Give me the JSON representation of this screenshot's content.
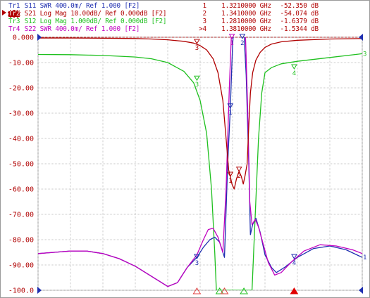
{
  "traces": [
    {
      "id": "Tr1",
      "param": "S11",
      "format": "SWR",
      "scale": "400.0m/",
      "ref": "Ref 1.000",
      "channel": "[F2]",
      "color": "#1f2fb0",
      "active": false
    },
    {
      "id": "Tr2",
      "param": "S21",
      "format": "Log Mag",
      "scale": "10.00dB/",
      "ref": "Ref 0.000dB",
      "channel": "[F2]",
      "color": "#b00000",
      "active": true
    },
    {
      "id": "Tr3",
      "param": "S12",
      "format": "Log Mag",
      "scale": "1.000dB/",
      "ref": "Ref 0.000dB",
      "channel": "[F2]",
      "color": "#1fc01f",
      "active": false
    },
    {
      "id": "Tr4",
      "param": "S22",
      "format": "SWR",
      "scale": "400.0m/",
      "ref": "Ref 1.000",
      "channel": "[F2]",
      "color": "#c000c0",
      "active": false
    }
  ],
  "marker_readout": [
    {
      "num": "1",
      "freq": "1.3210000 GHz",
      "value": "-52.350 dB"
    },
    {
      "num": "2",
      "freq": "1.3410000 GHz",
      "value": "-54.074 dB"
    },
    {
      "num": "3",
      "freq": "1.2810000 GHz",
      "value": "-1.6379 dB"
    },
    {
      "num": ">4",
      "freq": "1.3810000 GHz",
      "value": "-1.5344 dB"
    }
  ],
  "chart_data": {
    "type": "line",
    "title": "",
    "xlabel": "",
    "ylabel": "",
    "yticks": [
      "0.000",
      "-10.00",
      "-20.00",
      "-30.00",
      "-40.00",
      "-50.00",
      "-60.00",
      "-70.00",
      "-80.00",
      "-90.00",
      "-100.0"
    ],
    "ylim": [
      -100,
      0
    ],
    "xlim": [
      0,
      10
    ],
    "grid": true,
    "series": [
      {
        "name": "Tr1",
        "color": "#1f2fb0",
        "points": [
          [
            0,
            -85.5
          ],
          [
            0.5,
            -85
          ],
          [
            1,
            -84.5
          ],
          [
            1.5,
            -84.5
          ],
          [
            2,
            -85.5
          ],
          [
            2.5,
            -87.5
          ],
          [
            3,
            -90.5
          ],
          [
            3.5,
            -94.5
          ],
          [
            4,
            -98.5
          ],
          [
            4.3,
            -97
          ],
          [
            4.6,
            -91
          ],
          [
            4.9,
            -87
          ],
          [
            5.1,
            -83
          ],
          [
            5.3,
            -80
          ],
          [
            5.45,
            -79
          ],
          [
            5.6,
            -81
          ],
          [
            5.75,
            -87
          ],
          [
            5.85,
            -50
          ],
          [
            5.93,
            -28
          ],
          [
            6.0,
            -3
          ],
          [
            6.05,
            5
          ],
          [
            6.3,
            5
          ],
          [
            6.35,
            2
          ],
          [
            6.42,
            -15
          ],
          [
            6.5,
            -50
          ],
          [
            6.55,
            -78
          ],
          [
            6.62,
            -74
          ],
          [
            6.72,
            -71.5
          ],
          [
            6.85,
            -77
          ],
          [
            7.0,
            -86
          ],
          [
            7.2,
            -91
          ],
          [
            7.35,
            -93
          ],
          [
            7.6,
            -91
          ],
          [
            8,
            -87
          ],
          [
            8.5,
            -83.5
          ],
          [
            9,
            -82.5
          ],
          [
            9.5,
            -84
          ],
          [
            10,
            -87
          ]
        ]
      },
      {
        "name": "Tr2",
        "color": "#b00000",
        "points": [
          [
            0,
            -0.3
          ],
          [
            1,
            -0.3
          ],
          [
            2,
            -0.4
          ],
          [
            3,
            -0.5
          ],
          [
            3.5,
            -0.7
          ],
          [
            4,
            -1
          ],
          [
            4.5,
            -1.6
          ],
          [
            4.8,
            -2.3
          ],
          [
            5.0,
            -3.3
          ],
          [
            5.2,
            -5
          ],
          [
            5.4,
            -8.5
          ],
          [
            5.55,
            -14
          ],
          [
            5.7,
            -25
          ],
          [
            5.8,
            -40
          ],
          [
            5.88,
            -52.5
          ],
          [
            5.93,
            -55
          ],
          [
            5.98,
            -58
          ],
          [
            6.05,
            -60
          ],
          [
            6.12,
            -56
          ],
          [
            6.2,
            -53
          ],
          [
            6.27,
            -55
          ],
          [
            6.33,
            -58
          ],
          [
            6.38,
            -55
          ],
          [
            6.45,
            -50
          ],
          [
            6.5,
            -35
          ],
          [
            6.55,
            -22
          ],
          [
            6.62,
            -14
          ],
          [
            6.72,
            -9
          ],
          [
            6.85,
            -6
          ],
          [
            7.0,
            -4
          ],
          [
            7.2,
            -2.7
          ],
          [
            7.5,
            -1.8
          ],
          [
            8,
            -1.2
          ],
          [
            9,
            -0.7
          ],
          [
            10,
            -0.5
          ]
        ]
      },
      {
        "name": "Tr3",
        "color": "#1fc01f",
        "points": [
          [
            0,
            -6.8
          ],
          [
            1,
            -6.9
          ],
          [
            2,
            -7.2
          ],
          [
            3,
            -7.8
          ],
          [
            3.5,
            -8.5
          ],
          [
            4,
            -10
          ],
          [
            4.5,
            -13.5
          ],
          [
            4.8,
            -18
          ],
          [
            5.0,
            -25
          ],
          [
            5.2,
            -38
          ],
          [
            5.35,
            -60
          ],
          [
            5.45,
            -85
          ],
          [
            5.5,
            -100
          ],
          [
            6.6,
            -100
          ],
          [
            6.7,
            -70
          ],
          [
            6.8,
            -40
          ],
          [
            6.9,
            -22
          ],
          [
            7.0,
            -14
          ],
          [
            7.2,
            -12
          ],
          [
            7.5,
            -10.5
          ],
          [
            8,
            -9.5
          ],
          [
            9,
            -8
          ],
          [
            10,
            -6.5
          ]
        ]
      },
      {
        "name": "Tr4",
        "color": "#c000c0",
        "points": [
          [
            0,
            -85.5
          ],
          [
            0.5,
            -85
          ],
          [
            1,
            -84.5
          ],
          [
            1.5,
            -84.5
          ],
          [
            2,
            -85.5
          ],
          [
            2.5,
            -87.5
          ],
          [
            3,
            -90.5
          ],
          [
            3.5,
            -94.5
          ],
          [
            4,
            -98.5
          ],
          [
            4.3,
            -97
          ],
          [
            4.6,
            -91
          ],
          [
            4.9,
            -86
          ],
          [
            5.1,
            -80
          ],
          [
            5.25,
            -76
          ],
          [
            5.4,
            -75.5
          ],
          [
            5.55,
            -79
          ],
          [
            5.7,
            -85
          ],
          [
            5.8,
            -60
          ],
          [
            5.9,
            -20
          ],
          [
            5.96,
            0
          ],
          [
            6.02,
            5
          ],
          [
            6.35,
            5
          ],
          [
            6.4,
            0
          ],
          [
            6.47,
            -30
          ],
          [
            6.53,
            -65
          ],
          [
            6.6,
            -74
          ],
          [
            6.7,
            -72
          ],
          [
            6.8,
            -75
          ],
          [
            6.95,
            -82
          ],
          [
            7.1,
            -89
          ],
          [
            7.3,
            -94
          ],
          [
            7.5,
            -93
          ],
          [
            7.8,
            -89
          ],
          [
            8.2,
            -84.5
          ],
          [
            8.7,
            -82
          ],
          [
            9.2,
            -82.5
          ],
          [
            9.7,
            -84
          ],
          [
            10,
            -85.5
          ]
        ]
      }
    ],
    "markers": [
      {
        "label": "1",
        "x": 5.93,
        "y": -28,
        "color": "#1f2fb0"
      },
      {
        "label": "2",
        "x": 6.2,
        "y": -53,
        "color": "#b00000"
      },
      {
        "label": "1",
        "x": 5.93,
        "y": -55,
        "color": "#b00000"
      },
      {
        "label": "3",
        "x": 4.9,
        "y": -2.5,
        "color": "#b00000"
      },
      {
        "label": "1",
        "x": 5.98,
        "y": -0.5,
        "color": "#c000c0"
      },
      {
        "label": "2",
        "x": 6.3,
        "y": -0.5,
        "color": "#1f2fb0"
      },
      {
        "label": "3",
        "x": 4.9,
        "y": -17,
        "color": "#1fc01f"
      },
      {
        "label": "4",
        "x": 7.9,
        "y": -12.5,
        "color": "#1fc01f"
      },
      {
        "label": "3",
        "x": 4.9,
        "y": -87.5,
        "color": "#1f2fb0"
      },
      {
        "label": "4",
        "x": 7.9,
        "y": -87.5,
        "color": "#1f2fb0"
      }
    ],
    "bottom_markers": [
      {
        "x": 4.9,
        "color": "#e04040",
        "filled": false
      },
      {
        "x": 5.6,
        "color": "#1fc01f",
        "filled": false
      },
      {
        "x": 5.75,
        "color": "#e04040",
        "filled": false
      },
      {
        "x": 6.35,
        "color": "#1fc01f",
        "filled": false
      },
      {
        "x": 7.9,
        "color": "#e00000",
        "filled": true
      }
    ]
  }
}
